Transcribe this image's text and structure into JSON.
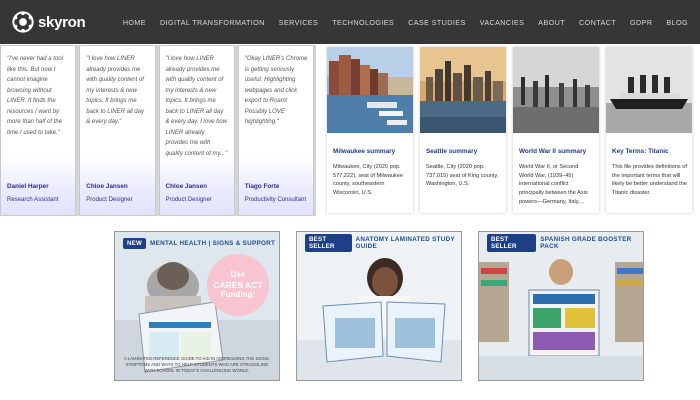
{
  "brand": {
    "name": "skyron",
    "accent": "#363636"
  },
  "nav": {
    "items": [
      "HOME",
      "DIGITAL TRANSFORMATION",
      "SERVICES",
      "TECHNOLOGIES",
      "CASE STUDIES",
      "VACANCIES",
      "ABOUT",
      "CONTACT",
      "GDPR",
      "BLOG"
    ]
  },
  "testimonials": [
    {
      "quote": "\"I've never had a tool like this. But now I cannot imagine browsing without LINER. It finds the resources I want by more than half of the time I used to take.\"",
      "name": "Daniel Harper",
      "role": "Research Assistant"
    },
    {
      "quote": "\"I love how LINER already provides me with quality content of my interests & new topics. It brings me back to LINER all day & every day.\"",
      "name": "Chloe Jansen",
      "role": "Product Designer"
    },
    {
      "quote": "\"I love how LINER already provides me with quality content of my interests & new topics. It brings me back to LINER all day & every day. I love how LINER already provides me with quality content of my...\"",
      "name": "Chloe Jansen",
      "role": "Product Designer"
    },
    {
      "quote": "\"Okay LINER's Chrome is getting seriously useful. Highlighting webpages and click export to Roam! Possibly LOVE highlighting.\"",
      "name": "Tiago Forte",
      "role": "Productivity Consultant"
    }
  ],
  "summaries": [
    {
      "title": "Milwaukee summary",
      "body": "Milwaukee, City (2020 pop. 577,222), seat of Milwaukee county, southeastern Wisconsin, U.S."
    },
    {
      "title": "Seattle summary",
      "body": "Seattle, City (2020 pop. 737,015) seat of King county, Washington, U.S."
    },
    {
      "title": "World War II summary",
      "body": "World War II, or Second World War, (1939–45) international conflict principally between the Axis powers—Germany, Italy,..."
    },
    {
      "title": "Key Terms: Titanic",
      "body": "This file provides definitions of the important terms that will likely be better understand the Titanic disaster."
    }
  ],
  "products": [
    {
      "badge": "NEW",
      "banner": "MENTAL HEALTH | SIGNS & SUPPORT",
      "stamp_line1": "Use",
      "stamp_line2": "CARES ACT",
      "stamp_line3": "Funding!",
      "caption": "A laminated reference guide to aid in addressing the signs, symptoms and ways to help students who are struggling with school in today's challenging world."
    },
    {
      "badge": "BEST SELLER",
      "banner": "ANATOMY LAMINATED STUDY GUIDE",
      "caption": ""
    },
    {
      "badge": "BEST SELLER",
      "banner": "SPANISH GRADE BOOSTER PACK",
      "caption": ""
    }
  ]
}
